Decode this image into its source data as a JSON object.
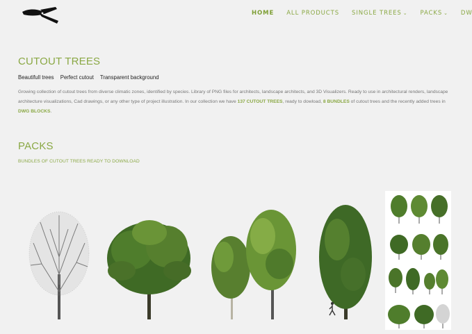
{
  "header": {
    "logo_icon": "pruning-shears-logo-icon",
    "nav": [
      {
        "label": "HOME",
        "active": true
      },
      {
        "label": "ALL PRODUCTS"
      },
      {
        "label": "SINGLE TREES",
        "dropdown": true
      },
      {
        "label": "PACKS",
        "dropdown": true
      },
      {
        "label": "DWG"
      }
    ]
  },
  "intro": {
    "title": "CUTOUT TREES",
    "tags": [
      "Beautifull trees",
      "Perfect cutout",
      "Transparent background"
    ],
    "description": {
      "part1": "Growing collection of cutout trees from diverse climatic zones, identified by species. Library of PNG files for architects, landscape architects, and 3D Visualizers. Ready to use in architectural renders, landscape architecture visualizations, Cad drawings, or any other type of project illustration. In our collection we have ",
      "link1": "137 CUTOUT TREES",
      "part2": ", ready to dowload, ",
      "link2": "8 BUNDLES",
      "part3": " of cutout trees and the recently added trees in ",
      "link3": "DWG BLOCKS",
      "part4": "."
    }
  },
  "packs": {
    "title": "PACKS",
    "subtitle": "BUNDLES OF CUTOUT TREES READY TO DOWNLOAD"
  },
  "colors": {
    "accent": "#8aa844",
    "background": "#f1f1f1",
    "foliage_dark": "#3f6a25",
    "foliage_light": "#7ea33a",
    "bare_tree": "#6b6b6b"
  }
}
